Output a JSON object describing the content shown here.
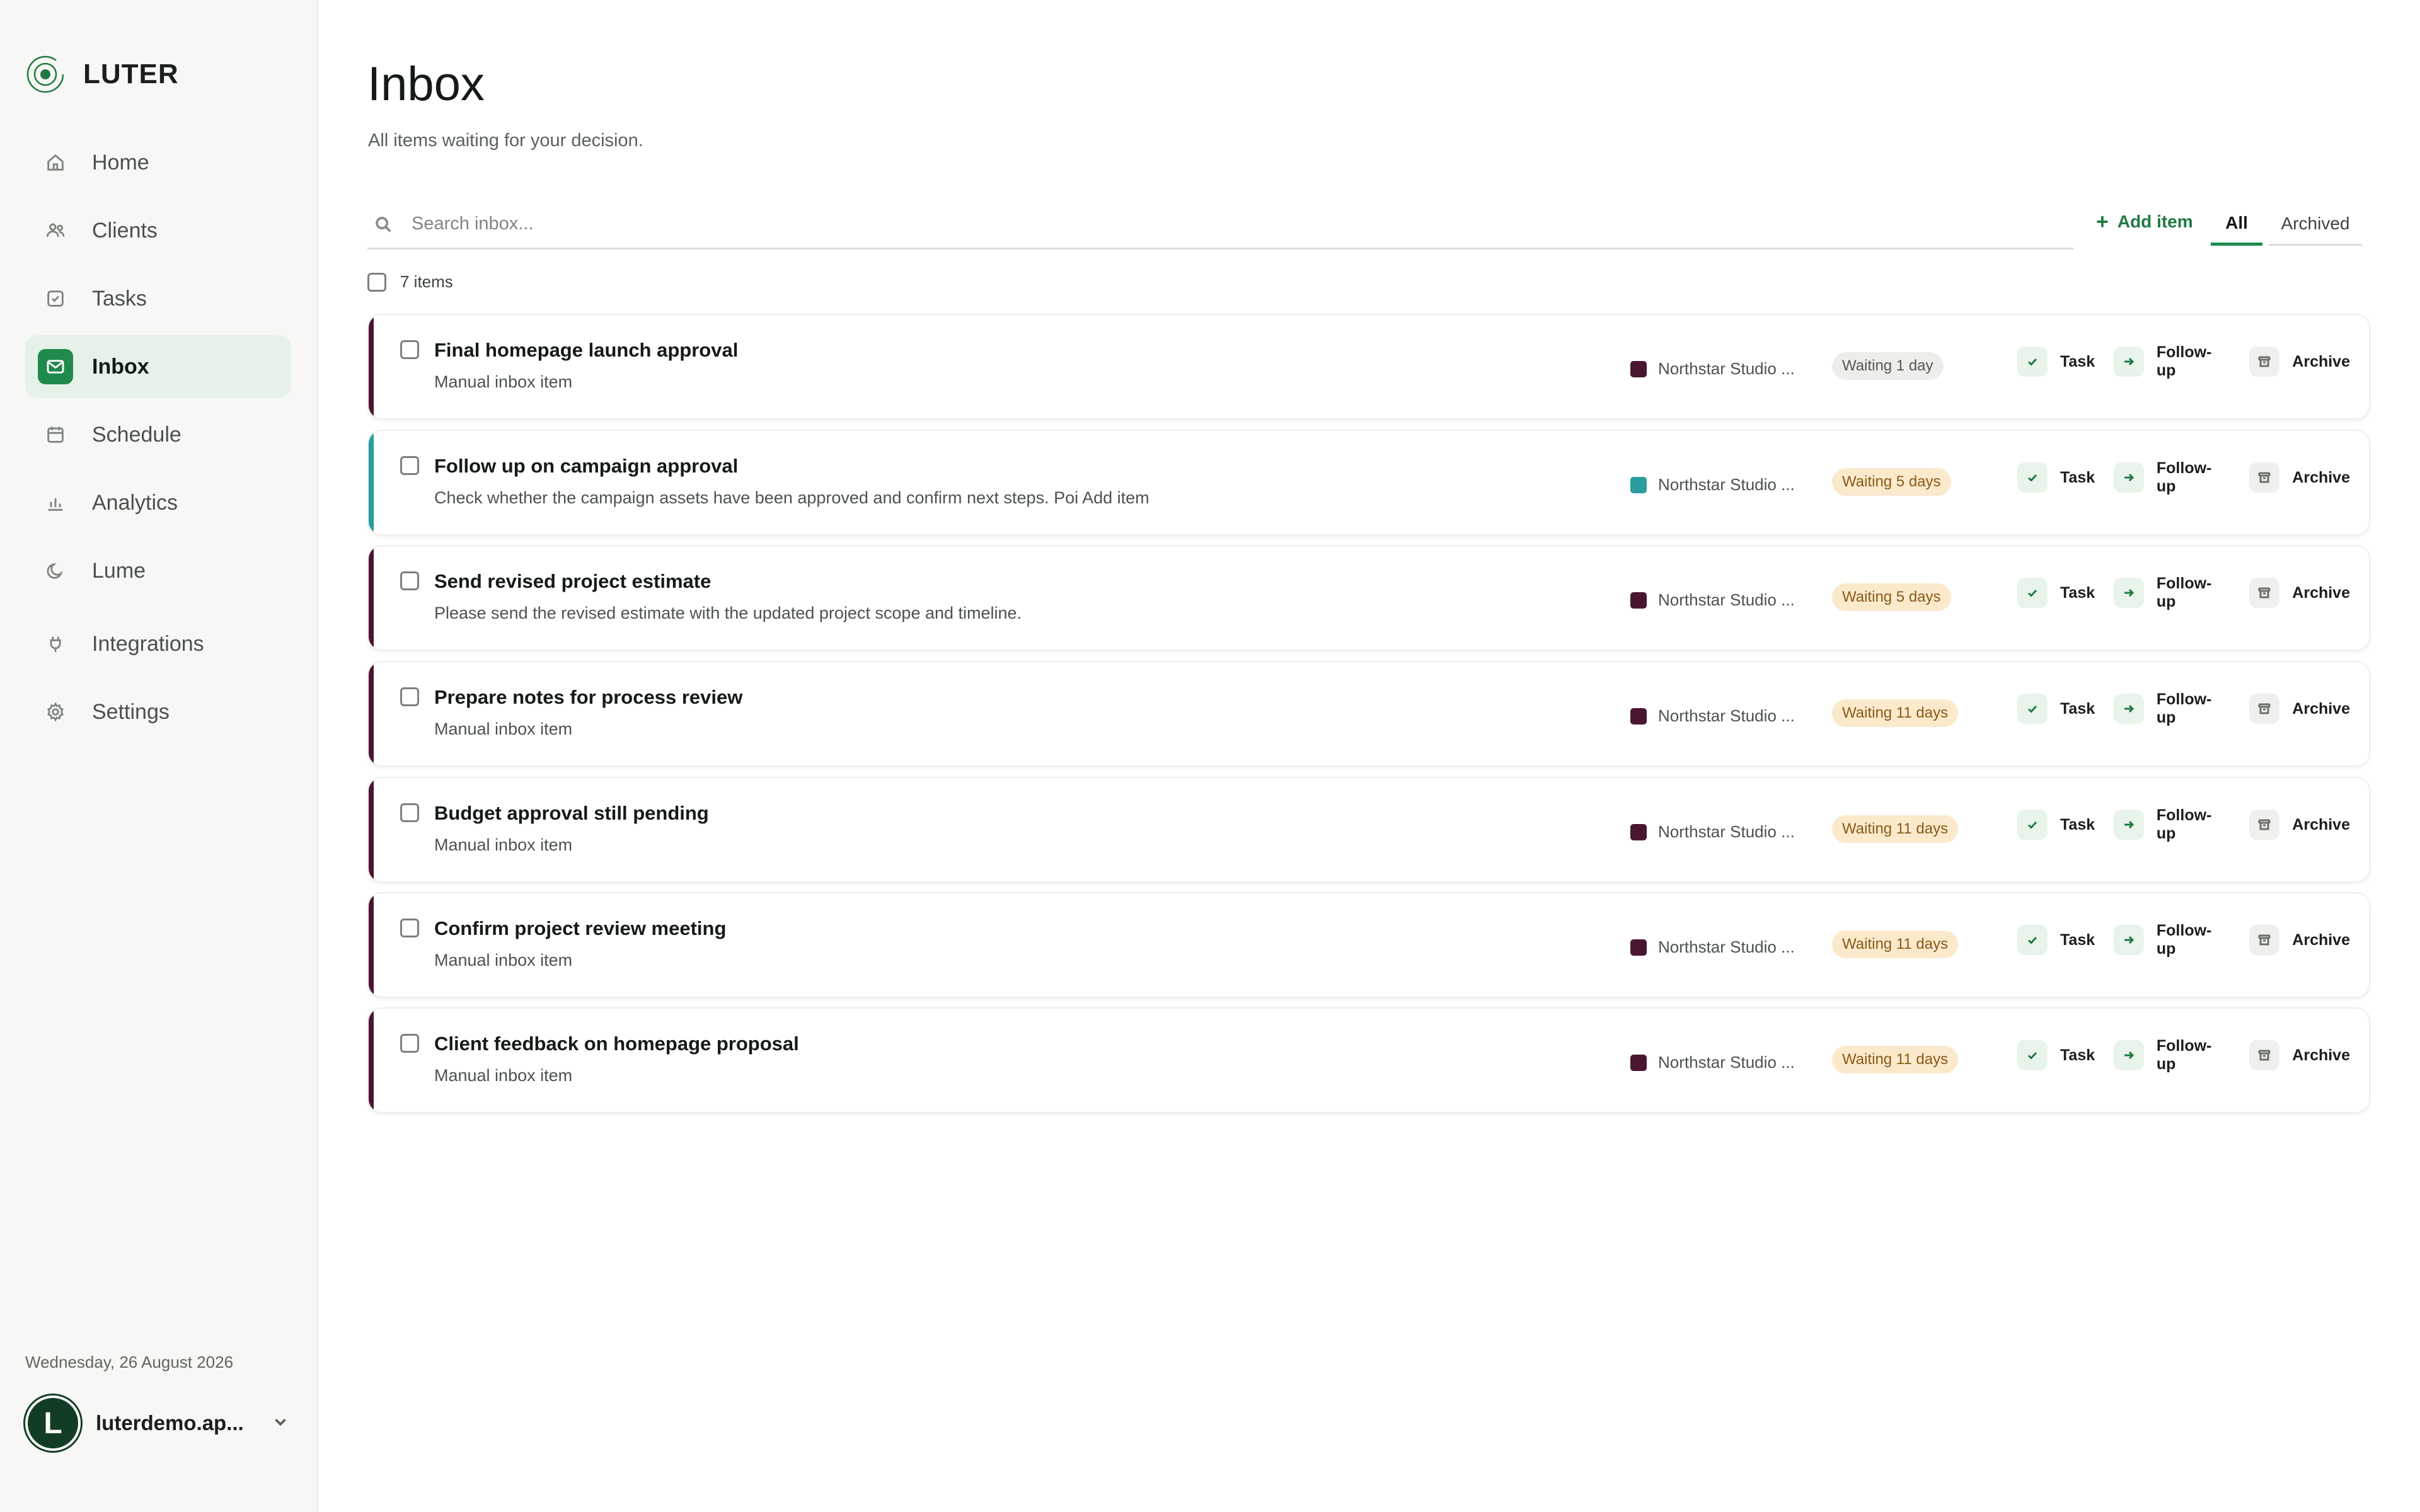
{
  "brand": {
    "name": "LUTER"
  },
  "sidebar": {
    "items": [
      {
        "label": "Home",
        "icon": "home-icon",
        "active": false
      },
      {
        "label": "Clients",
        "icon": "users-icon",
        "active": false
      },
      {
        "label": "Tasks",
        "icon": "task-check-icon",
        "active": false
      },
      {
        "label": "Inbox",
        "icon": "inbox-icon",
        "active": true
      },
      {
        "label": "Schedule",
        "icon": "calendar-icon",
        "active": false
      },
      {
        "label": "Analytics",
        "icon": "bar-chart-icon",
        "active": false
      },
      {
        "label": "Lume",
        "icon": "moon-icon",
        "active": false
      },
      {
        "label": "Integrations",
        "icon": "plug-icon",
        "active": false
      },
      {
        "label": "Settings",
        "icon": "gear-icon",
        "active": false
      }
    ],
    "date": "Wednesday, 26 August 2026",
    "user": {
      "initial": "L",
      "name": "luterdemo.ap..."
    }
  },
  "header": {
    "title": "Inbox",
    "subtitle": "All items waiting for your decision."
  },
  "search": {
    "placeholder": "Search inbox...",
    "value": ""
  },
  "toolbar": {
    "add_label": "Add item",
    "add_symbol": "+"
  },
  "tabs": [
    {
      "label": "All",
      "selected": true
    },
    {
      "label": "Archived",
      "selected": false
    }
  ],
  "list_meta": {
    "count_label": "7 items"
  },
  "colors": {
    "accent_green": "#1f8a4c",
    "client_maroon": "#4a1530",
    "client_teal": "#2a9d9f",
    "badge_amber_bg": "#fbe9cc",
    "badge_grey_bg": "#ededeb"
  },
  "actions": {
    "task": "Task",
    "followup": "Follow-up",
    "archive": "Archive"
  },
  "items": [
    {
      "title": "Final homepage launch approval",
      "description": "Manual inbox item",
      "client": "Northstar Studio ...",
      "client_color": "#4a1530",
      "accent": "#4a1530",
      "waiting": "Waiting 1 day",
      "badge_style": "grey"
    },
    {
      "title": "Follow up on campaign approval",
      "description": "Check whether the campaign assets have been approved and confirm next steps. Poi Add item",
      "client": "Northstar Studio ...",
      "client_color": "#2a9d9f",
      "accent": "#2a9d9f",
      "waiting": "Waiting 5 days",
      "badge_style": "amber"
    },
    {
      "title": "Send revised project estimate",
      "description": "Please send the revised estimate with the updated project scope and timeline.",
      "client": "Northstar Studio ...",
      "client_color": "#4a1530",
      "accent": "#4a1530",
      "waiting": "Waiting 5 days",
      "badge_style": "amber"
    },
    {
      "title": "Prepare notes for process review",
      "description": "Manual inbox item",
      "client": "Northstar Studio ...",
      "client_color": "#4a1530",
      "accent": "#4a1530",
      "waiting": "Waiting 11 days",
      "badge_style": "amber"
    },
    {
      "title": "Budget approval still pending",
      "description": "Manual inbox item",
      "client": "Northstar Studio ...",
      "client_color": "#4a1530",
      "accent": "#4a1530",
      "waiting": "Waiting 11 days",
      "badge_style": "amber"
    },
    {
      "title": "Confirm project review meeting",
      "description": "Manual inbox item",
      "client": "Northstar Studio ...",
      "client_color": "#4a1530",
      "accent": "#4a1530",
      "waiting": "Waiting 11 days",
      "badge_style": "amber"
    },
    {
      "title": "Client feedback on homepage proposal",
      "description": "Manual inbox item",
      "client": "Northstar Studio ...",
      "client_color": "#4a1530",
      "accent": "#4a1530",
      "waiting": "Waiting 11 days",
      "badge_style": "amber"
    }
  ]
}
